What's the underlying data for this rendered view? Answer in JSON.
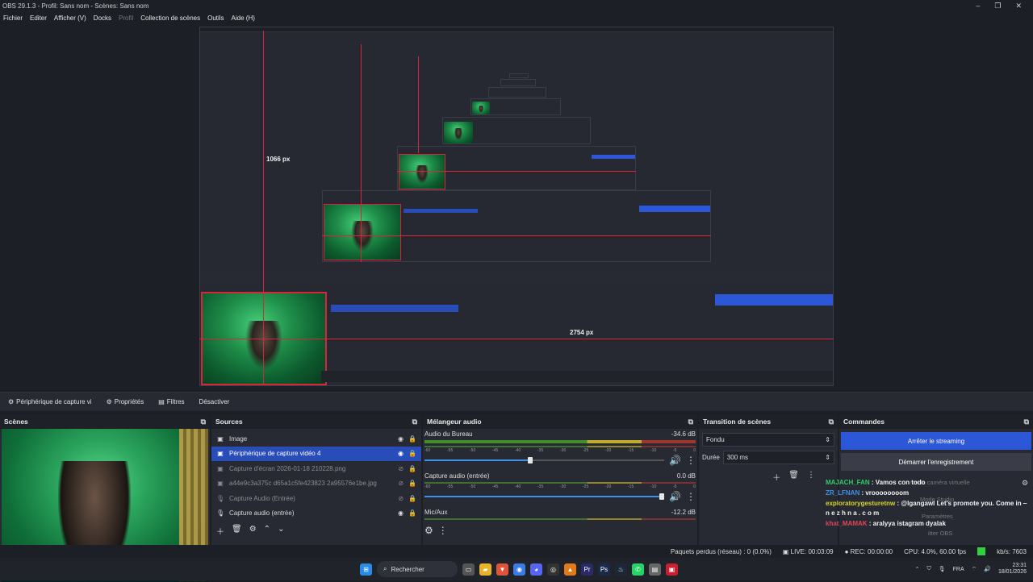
{
  "titlebar": {
    "title": "OBS 29.1.3 - Profil: Sans nom - Scènes: Sans nom",
    "minimize": "–",
    "maximize": "❐",
    "close": "✕"
  },
  "menu": {
    "file": "Fichier",
    "edit": "Editer",
    "view": "Afficher (V)",
    "docks": "Docks",
    "profile": "Profil",
    "scenes": "Collection de scènes",
    "tools": "Outils",
    "help": "Aide (H)"
  },
  "preview": {
    "label_height": "1066 px",
    "label_width": "2754 px"
  },
  "source_toolbar": {
    "selected": "Périphérique de capture vi",
    "properties": "Propriétés",
    "filters": "Filtres",
    "deactivate": "Désactiver"
  },
  "docks": {
    "scenes": {
      "title": "Scènes"
    },
    "sources": {
      "title": "Sources",
      "items": [
        {
          "icon": "image-icon",
          "glyph": "▣",
          "label": "Image",
          "eye": "◉",
          "lock": "🔒"
        },
        {
          "icon": "camera-icon",
          "glyph": "▣",
          "label": "Périphérique de capture vidéo 4",
          "eye": "◉",
          "lock": "🔒"
        },
        {
          "icon": "image-icon",
          "glyph": "▣",
          "label": "Capture d'écran 2026-01-18 210228.png",
          "eye": "⊘",
          "lock": "🔒"
        },
        {
          "icon": "image-icon",
          "glyph": "▣",
          "label": "a44e9c3a375c d65a1c5fe423823 2a95576e1be.jpg",
          "eye": "⊘",
          "lock": "🔒"
        },
        {
          "icon": "mic-icon",
          "glyph": "🎙",
          "label": "Capture Audio (Entrée)",
          "eye": "⊘",
          "lock": "🔒"
        },
        {
          "icon": "mic-icon",
          "glyph": "🎙",
          "label": "Capture audio (entrée)",
          "eye": "◉",
          "lock": "🔒"
        }
      ]
    },
    "mixer": {
      "title": "Mélangeur audio",
      "channels": [
        {
          "name": "Audio du Bureau",
          "db": "-34.6 dB",
          "level": 0.55,
          "fader": 0.44
        },
        {
          "name": "Capture audio (entrée)",
          "db": "0.0 dB",
          "level": 0.0,
          "fader": 0.99
        },
        {
          "name": "Mic/Aux",
          "db": "-12.2 dB",
          "level": 0.0,
          "fader": 0.0
        }
      ],
      "ticks": [
        "-60",
        "-55",
        "-50",
        "-45",
        "-40",
        "-35",
        "-30",
        "-25",
        "-20",
        "-15",
        "-10",
        "-5",
        "0"
      ]
    },
    "transitions": {
      "title": "Transition de scènes",
      "type": "Fondu",
      "duration_label": "Durée",
      "duration": "300 ms"
    },
    "commands": {
      "title": "Commandes",
      "stop_stream": "Arrêter le streaming",
      "start_record": "Démarrer l'enregistrement",
      "virtual_cam": "rrer la caméra virtuelle",
      "studio": "Mode Studio",
      "settings": "Paramètres",
      "quit": "itter OBS"
    }
  },
  "chat": [
    {
      "user": "MAJACH_FAN",
      "color": "#2ecf6a",
      "msg": " : Vamos con todo"
    },
    {
      "user": "ZR_LFNAN",
      "color": "#3f8fe6",
      "msg": " : vroooooooom"
    },
    {
      "user": "exploratorygesturetnw",
      "color": "#d6d62a",
      "msg": " : @lgangawl Let's promote you. Come in ‒ n e z h n a . c o m"
    },
    {
      "user": "khat_MAMAK",
      "color": "#e0455a",
      "msg": " : aralyya istagram dyalak"
    }
  ],
  "status": {
    "dropped": "Paquets perdus (réseau) : 0 (0.0%)",
    "live": "LIVE: 00:03:09",
    "rec": "REC: 00:00:00",
    "cpu": "CPU: 4.0%, 60.00 fps",
    "kbps": "kb/s: 7603"
  },
  "taskbar": {
    "search": "Rechercher",
    "lang": "FRA",
    "time": "23:31",
    "date": "18/01/2026"
  }
}
